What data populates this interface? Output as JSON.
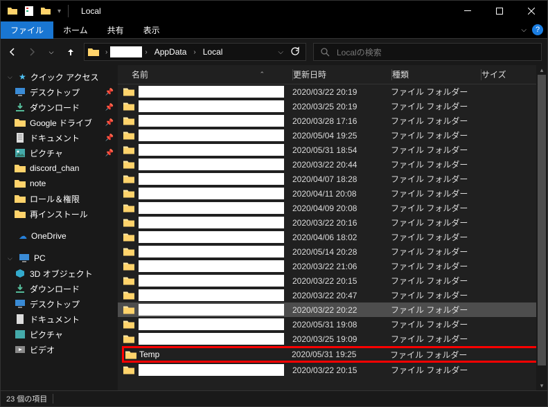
{
  "title": "Local",
  "ribbon": {
    "file": "ファイル",
    "home": "ホーム",
    "share": "共有",
    "view": "表示"
  },
  "breadcrumb": {
    "seg1": "",
    "seg2": "AppData",
    "seg3": "Local"
  },
  "search": {
    "placeholder": "Localの検索"
  },
  "sidebar": {
    "quick": "クイック アクセス",
    "desktop": "デスクトップ",
    "downloads": "ダウンロード",
    "gdrive": "Google ドライブ",
    "documents": "ドキュメント",
    "pictures": "ピクチャ",
    "discord": "discord_chan",
    "note": "note",
    "roles": "ロール＆権限",
    "reinstall": "再インストール",
    "onedrive": "OneDrive",
    "pc": "PC",
    "objects3d": "3D オブジェクト",
    "downloads2": "ダウンロード",
    "desktop2": "デスクトップ",
    "documents2": "ドキュメント",
    "pictures2": "ピクチャ",
    "video": "ビデオ"
  },
  "columns": {
    "name": "名前",
    "date": "更新日時",
    "type": "種類",
    "size": "サイズ"
  },
  "rows": [
    {
      "name": "",
      "date": "2020/03/22 20:19",
      "type": "ファイル フォルダー"
    },
    {
      "name": "",
      "date": "2020/03/25 20:19",
      "type": "ファイル フォルダー"
    },
    {
      "name": "",
      "date": "2020/03/28 17:16",
      "type": "ファイル フォルダー"
    },
    {
      "name": "",
      "date": "2020/05/04 19:25",
      "type": "ファイル フォルダー"
    },
    {
      "name": "",
      "date": "2020/05/31 18:54",
      "type": "ファイル フォルダー"
    },
    {
      "name": "",
      "date": "2020/03/22 20:44",
      "type": "ファイル フォルダー"
    },
    {
      "name": "",
      "date": "2020/04/07 18:28",
      "type": "ファイル フォルダー"
    },
    {
      "name": "",
      "date": "2020/04/11 20:08",
      "type": "ファイル フォルダー"
    },
    {
      "name": "",
      "date": "2020/04/09 20:08",
      "type": "ファイル フォルダー"
    },
    {
      "name": "",
      "date": "2020/03/22 20:16",
      "type": "ファイル フォルダー"
    },
    {
      "name": "",
      "date": "2020/04/06 18:02",
      "type": "ファイル フォルダー"
    },
    {
      "name": "",
      "date": "2020/05/14 20:28",
      "type": "ファイル フォルダー"
    },
    {
      "name": "",
      "date": "2020/03/22 21:06",
      "type": "ファイル フォルダー"
    },
    {
      "name": "",
      "date": "2020/03/22 20:15",
      "type": "ファイル フォルダー"
    },
    {
      "name": "",
      "date": "2020/03/22 20:47",
      "type": "ファイル フォルダー"
    },
    {
      "name": "",
      "date": "2020/03/22 20:22",
      "type": "ファイル フォルダー",
      "selected": true
    },
    {
      "name": "",
      "date": "2020/05/31 19:08",
      "type": "ファイル フォルダー"
    },
    {
      "name": "",
      "date": "2020/03/25 19:09",
      "type": "ファイル フォルダー"
    },
    {
      "name": "Temp",
      "date": "2020/05/31 19:25",
      "type": "ファイル フォルダー",
      "highlight": true
    },
    {
      "name": "",
      "date": "2020/03/22 20:15",
      "type": "ファイル フォルダー"
    }
  ],
  "status": {
    "count": "23 個の項目"
  }
}
